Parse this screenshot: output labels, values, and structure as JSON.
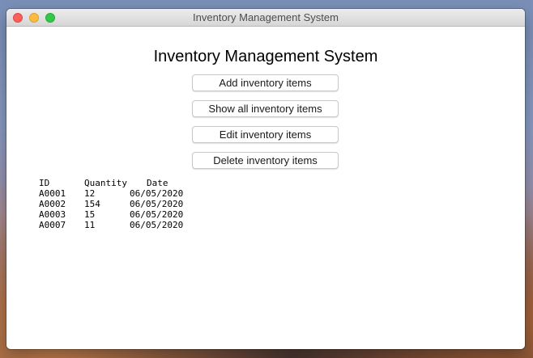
{
  "window": {
    "title": "Inventory Management System"
  },
  "main": {
    "heading": "Inventory Management System",
    "buttons": [
      {
        "label": "Add inventory items"
      },
      {
        "label": "Show all inventory items"
      },
      {
        "label": "Edit inventory items"
      },
      {
        "label": "Delete inventory items"
      }
    ]
  },
  "table": {
    "headers": [
      "ID",
      "Quantity",
      "Date"
    ],
    "rows": [
      [
        "A0001",
        "12",
        "06/05/2020"
      ],
      [
        "A0002",
        "154",
        "06/05/2020"
      ],
      [
        "A0003",
        "15",
        "06/05/2020"
      ],
      [
        "A0007",
        "11",
        "06/05/2020"
      ]
    ]
  },
  "colors": {
    "close": "#fc605c",
    "minimize": "#fdbc40",
    "maximize": "#34c84a"
  }
}
